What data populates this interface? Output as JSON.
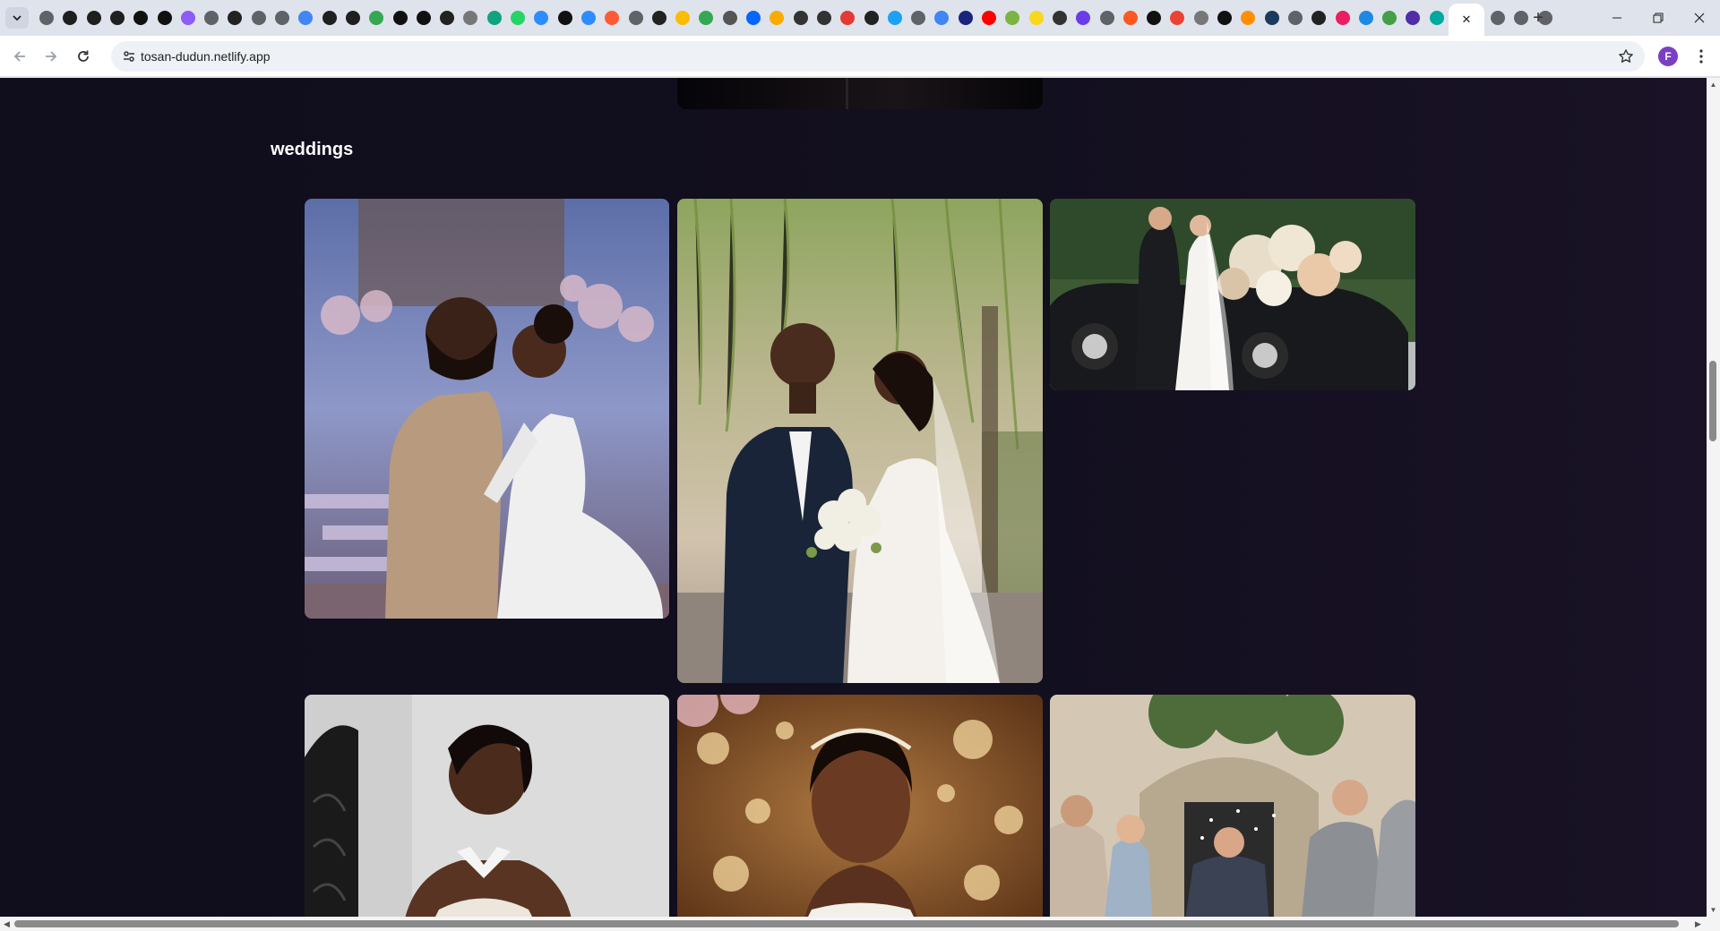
{
  "browser": {
    "tab_favicons": [
      {
        "icon": "chrome-icon",
        "color": "#5f6368"
      },
      {
        "icon": "github-icon",
        "color": "#1f1f1f"
      },
      {
        "icon": "upwork-icon",
        "color": "#1f1f1f"
      },
      {
        "icon": "threads-icon",
        "color": "#1f1f1f"
      },
      {
        "icon": "notion-icon",
        "color": "#111111"
      },
      {
        "icon": "notion-icon",
        "color": "#111111"
      },
      {
        "icon": "cube-icon",
        "color": "#8b5cf6"
      },
      {
        "icon": "globe-icon",
        "color": "#5f6368"
      },
      {
        "icon": "stack-icon",
        "color": "#222222"
      },
      {
        "icon": "globe-icon",
        "color": "#5f6368"
      },
      {
        "icon": "globe-icon",
        "color": "#5f6368"
      },
      {
        "icon": "sparkle-icon",
        "color": "#4285f4"
      },
      {
        "icon": "github-icon",
        "color": "#1f1f1f"
      },
      {
        "icon": "github-icon",
        "color": "#1f1f1f"
      },
      {
        "icon": "drive-icon",
        "color": "#34a853"
      },
      {
        "icon": "check-icon",
        "color": "#111111"
      },
      {
        "icon": "wf-icon",
        "color": "#111111"
      },
      {
        "icon": "compass-icon",
        "color": "#222222"
      },
      {
        "icon": "ok-icon",
        "color": "#777777"
      },
      {
        "icon": "circle-icon",
        "color": "#10a37f"
      },
      {
        "icon": "circle-icon",
        "color": "#25d366"
      },
      {
        "icon": "video-icon",
        "color": "#2d8cff"
      },
      {
        "icon": "brush-icon",
        "color": "#111111"
      },
      {
        "icon": "video-icon",
        "color": "#2d8cff"
      },
      {
        "icon": "globe-icon",
        "color": "#ff5a36"
      },
      {
        "icon": "globe-icon",
        "color": "#5f6368"
      },
      {
        "icon": "wave-icon",
        "color": "#222222"
      },
      {
        "icon": "chart-icon",
        "color": "#fbbc04"
      },
      {
        "icon": "dot-icon",
        "color": "#34a853"
      },
      {
        "icon": "m-icon",
        "color": "#555555"
      },
      {
        "icon": "meta-icon",
        "color": "#0866ff"
      },
      {
        "icon": "bot-icon",
        "color": "#f9ab00"
      },
      {
        "icon": "wiki-icon",
        "color": "#333333"
      },
      {
        "icon": "card-icon",
        "color": "#333333"
      },
      {
        "icon": "tag-icon",
        "color": "#e53935"
      },
      {
        "icon": "target-icon",
        "color": "#222222"
      },
      {
        "icon": "arrow-icon",
        "color": "#1da1f2"
      },
      {
        "icon": "globe-icon",
        "color": "#5f6368"
      },
      {
        "icon": "google-icon",
        "color": "#4285f4"
      },
      {
        "icon": "slate-icon",
        "color": "#1a237e"
      },
      {
        "icon": "youtube-icon",
        "color": "#ff0000"
      },
      {
        "icon": "android-icon",
        "color": "#7cb342"
      },
      {
        "icon": "ex-icon",
        "color": "#f9d71c"
      },
      {
        "icon": "planet-icon",
        "color": "#333333"
      },
      {
        "icon": "swirl-icon",
        "color": "#6a3de8"
      },
      {
        "icon": "globe-icon",
        "color": "#5f6368"
      },
      {
        "icon": "x-circle-icon",
        "color": "#ff5722"
      },
      {
        "icon": "x-icon",
        "color": "#111111"
      },
      {
        "icon": "gmail-icon",
        "color": "#ea4335"
      },
      {
        "icon": "mail-icon",
        "color": "#777777"
      },
      {
        "icon": "x-icon",
        "color": "#111111"
      },
      {
        "icon": "ring-icon",
        "color": "#ff8f00"
      },
      {
        "icon": "terminal-icon",
        "color": "#1b3a5c"
      },
      {
        "icon": "globe-icon",
        "color": "#5f6368"
      },
      {
        "icon": "mountain-icon",
        "color": "#222222"
      },
      {
        "icon": "heart-icon",
        "color": "#e91e63"
      },
      {
        "icon": "layout-icon",
        "color": "#1e88e5"
      },
      {
        "icon": "grid-icon",
        "color": "#43a047"
      },
      {
        "icon": "orb-icon",
        "color": "#512da8"
      },
      {
        "icon": "diamond-icon",
        "color": "#00a99d"
      }
    ],
    "active_tab_close": "✕",
    "inactive_after_active": [
      {
        "icon": "globe-icon",
        "color": "#5f6368"
      },
      {
        "icon": "chrome-icon",
        "color": "#5f6368"
      },
      {
        "icon": "chrome-icon",
        "color": "#5f6368"
      }
    ],
    "new_tab_label": "+",
    "url": "tosan-dudun.netlify.app",
    "profile_initial": "F"
  },
  "page": {
    "section_title": "weddings",
    "photos": [
      {
        "name": "couple-reception-photo",
        "alt": "Couple embracing at reception stage"
      },
      {
        "name": "couple-garden-photo",
        "alt": "Groom in tuxedo and bride with bouquet under willow tree"
      },
      {
        "name": "couple-vintage-car-photo",
        "alt": "Couple kissing beside vintage black car with flowers"
      },
      {
        "name": "bride-portrait-staircase-photo",
        "alt": "Bride portrait by staircase"
      },
      {
        "name": "bride-portrait-bokeh-photo",
        "alt": "Bride portrait with gold bokeh"
      },
      {
        "name": "confetti-exit-photo",
        "alt": "Guests throwing confetti at groom"
      }
    ]
  }
}
